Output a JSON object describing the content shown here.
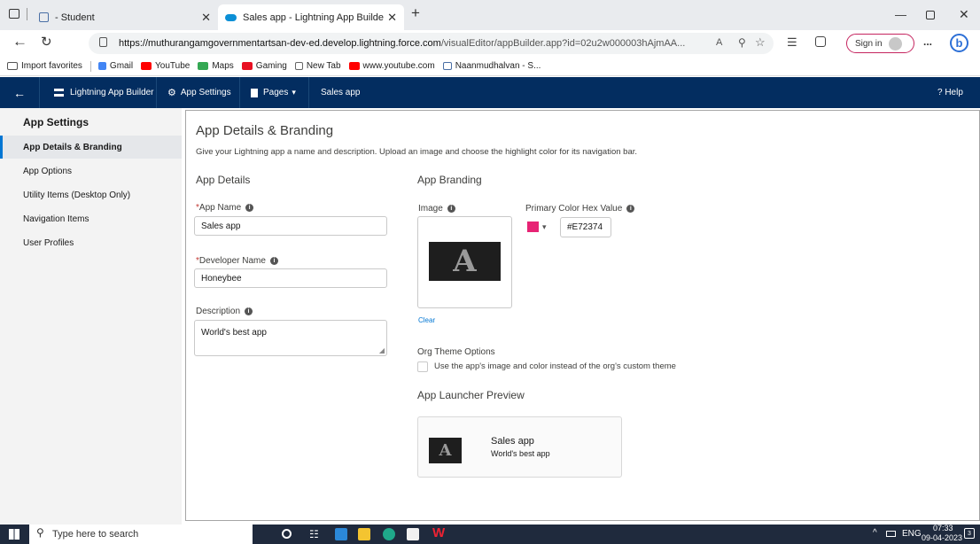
{
  "browser": {
    "tabs": [
      {
        "label": "- Student",
        "icon": "student-page-icon"
      },
      {
        "label": "Sales app - Lightning App Builde",
        "icon": "salesforce-cloud-icon"
      }
    ],
    "new_tab": "+",
    "url_host": "https://muthurangamgovernmentartsan-dev-ed.develop.lightning.force.com",
    "url_path": "/visualEditor/appBuilder.app?id=02u2w000003hAjmAA...",
    "signin_label": "Sign in",
    "more_label": "...",
    "favorites": [
      {
        "label": "Import favorites",
        "color": "#555555"
      },
      {
        "label": "Gmail",
        "color": "#4285f4"
      },
      {
        "label": "YouTube",
        "color": "#ff0000"
      },
      {
        "label": "Maps",
        "color": "#34a853"
      },
      {
        "label": "Gaming",
        "color": "#e81123"
      },
      {
        "label": "New Tab",
        "color": "#888888"
      },
      {
        "label": "www.youtube.com",
        "color": "#ff0000"
      },
      {
        "label": "Naanmudhalvan - S...",
        "color": "#4a6fa5"
      }
    ]
  },
  "appbar": {
    "builder_label": "Lightning App Builder",
    "settings_label": "App Settings",
    "pages_label": "Pages",
    "app_name": "Sales app",
    "help_label": "? Help"
  },
  "sidebar": {
    "title": "App Settings",
    "items": [
      {
        "label": "App Details & Branding",
        "active": true
      },
      {
        "label": "App Options"
      },
      {
        "label": "Utility Items (Desktop Only)"
      },
      {
        "label": "Navigation Items"
      },
      {
        "label": "User Profiles"
      }
    ]
  },
  "main": {
    "title": "App Details & Branding",
    "description": "Give your Lightning app a name and description. Upload an image and choose the highlight color for its navigation bar.",
    "details": {
      "heading": "App Details",
      "app_name_label": "App Name",
      "app_name_value": "Sales app",
      "developer_name_label": "Developer Name",
      "developer_name_value": "Honeybee",
      "description_label": "Description",
      "description_value": "World's best app"
    },
    "branding": {
      "heading": "App Branding",
      "image_label": "Image",
      "clear_label": "Clear",
      "color_label": "Primary Color Hex Value",
      "color_value": "#E72374",
      "color_swatch": "#e72374",
      "org_theme_label": "Org Theme Options",
      "org_theme_checkbox": "Use the app's image and color instead of the org's custom theme",
      "preview_heading": "App Launcher Preview",
      "preview_name": "Sales app",
      "preview_desc": "World's best app",
      "logo_letter": "A"
    }
  },
  "taskbar": {
    "search_placeholder": "Type here to search",
    "language": "ENG",
    "time": "07:33",
    "date": "09-04-2023",
    "notifications": "3"
  }
}
